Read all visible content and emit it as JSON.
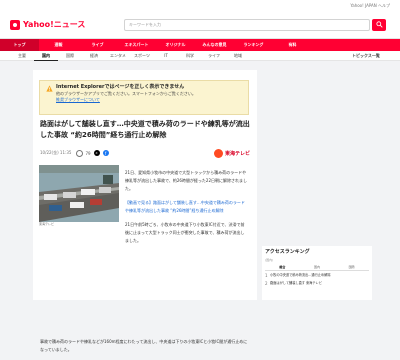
{
  "top_strip": {
    "text": "Yahoo! JAPAN ヘルプ"
  },
  "header": {
    "logo_text": "Yahoo!ニュース",
    "search_placeholder": "キーワードを入力"
  },
  "nav": {
    "items": [
      "トップ",
      "速報",
      "ライブ",
      "エキスパート",
      "オリジナル",
      "みんなの意見",
      "ランキング",
      "有料"
    ]
  },
  "subnav": {
    "items": [
      "主要",
      "国内",
      "国際",
      "経済",
      "エンタメ",
      "スポーツ",
      "IT",
      "科学",
      "ライフ",
      "地域"
    ],
    "tail": "トピックス一覧"
  },
  "ie_notice": {
    "title": "Internet Explorerではページを正しく表示できません",
    "text": "他のブラウザーかアプリでご覧ください。スマートフォンからご覧ください。",
    "link": "推奨ブラウザーについて"
  },
  "article": {
    "headline": "路面はがして舗装し直す…中央道で積み荷のラードや練乳等が流出した事故 “約26時間”経ち通行止め解除",
    "date": "10/22(金) 11:35",
    "comments": "79",
    "share_x": "X",
    "share_fb": "f",
    "provider": "東海テレビ",
    "caption": "東海テレビ",
    "paragraphs": [
      "21日、愛知県小牧市の中央道で大型トラックから積み荷のラードや練乳等が流出した事故で、約26時間が経った22日朝に解除されました。",
      "【動画で見る】路面はがして舗装し直す…中央道で積み荷のラードや練乳等が流出した事故 “約26時間”経ち通行止め解除",
      "21日午前5時ごろ、小牧市の中央道下り小牧東IC付近で、渋滞で前後に止まって大型トラック同士が衝突した事故で、積み荷が流出しました。"
    ],
    "tail_paragraph": "事故で積み荷のラードや練乳などが160m程度にわたって流出し、中央道は下りの小牧東ICと小牧IC間が通行止めになっていました。"
  },
  "ranking": {
    "title": "アクセスランキング",
    "subtitle": "(国内)",
    "tabs": [
      "総合",
      "国内",
      "国際"
    ],
    "items": [
      {
        "num": "1",
        "text": "小牧の中央道で積み荷流出…通行止め解除"
      },
      {
        "num": "2",
        "text": "路面はがして舗装し直す 東海テレビ"
      }
    ]
  },
  "colors": {
    "brand": "#ff0033",
    "link": "#1967d2",
    "warning_bg": "#fbf4d0",
    "provider": "#d90024"
  }
}
